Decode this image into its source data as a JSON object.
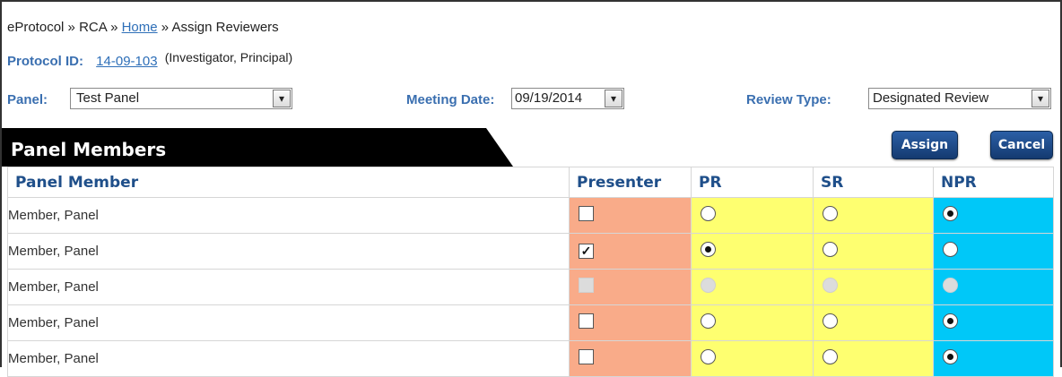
{
  "breadcrumb": {
    "item1": "eProtocol",
    "sep": "»",
    "item2": "RCA",
    "home_link": "Home",
    "current": "Assign Reviewers"
  },
  "protocol": {
    "label": "Protocol ID:",
    "id": "14-09-103",
    "role": "(Investigator, Principal)"
  },
  "filters": {
    "panel_label": "Panel:",
    "panel_value": "Test Panel",
    "meeting_label": "Meeting Date:",
    "meeting_value": "09/19/2014",
    "review_label": "Review Type:",
    "review_value": "Designated Review",
    "dropdown_arrow": "▾"
  },
  "section": {
    "title": "Panel Members",
    "assign_label": "Assign",
    "cancel_label": "Cancel"
  },
  "table": {
    "columns": [
      "Panel Member",
      "Presenter",
      "PR",
      "SR",
      "NPR"
    ],
    "rows": [
      {
        "name": "Member, Panel",
        "presenter": false,
        "selected": "NPR",
        "disabled": false
      },
      {
        "name": "Member, Panel",
        "presenter": true,
        "selected": "PR",
        "disabled": false
      },
      {
        "name": "Member, Panel",
        "presenter": false,
        "selected": "",
        "disabled": true
      },
      {
        "name": "Member, Panel",
        "presenter": false,
        "selected": "NPR",
        "disabled": false
      },
      {
        "name": "Member, Panel",
        "presenter": false,
        "selected": "NPR",
        "disabled": false
      }
    ]
  },
  "colors": {
    "presenter_bg": "#f9ab89",
    "pr_sr_bg": "#feff70",
    "npr_bg": "#00c8f8",
    "label_blue": "#3a6fb0",
    "button_blue": "#1f4d8c"
  }
}
